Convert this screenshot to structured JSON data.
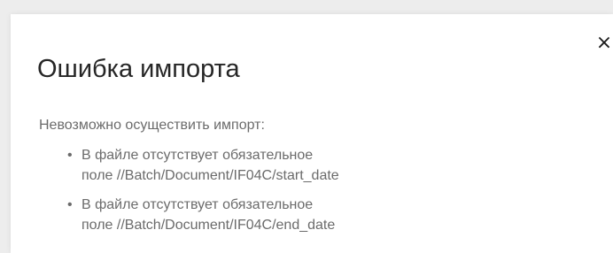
{
  "dialog": {
    "title": "Ошибка импорта",
    "close_label": "×",
    "message": "Невозможно осуществить импорт:",
    "errors": [
      {
        "line1": "В файле отсутствует обязательное",
        "line2": "поле //Batch/Document/IF04C/start_date"
      },
      {
        "line1": "В файле отсутствует обязательное",
        "line2": "поле //Batch/Document/IF04C/end_date"
      }
    ],
    "bullet": "•"
  }
}
